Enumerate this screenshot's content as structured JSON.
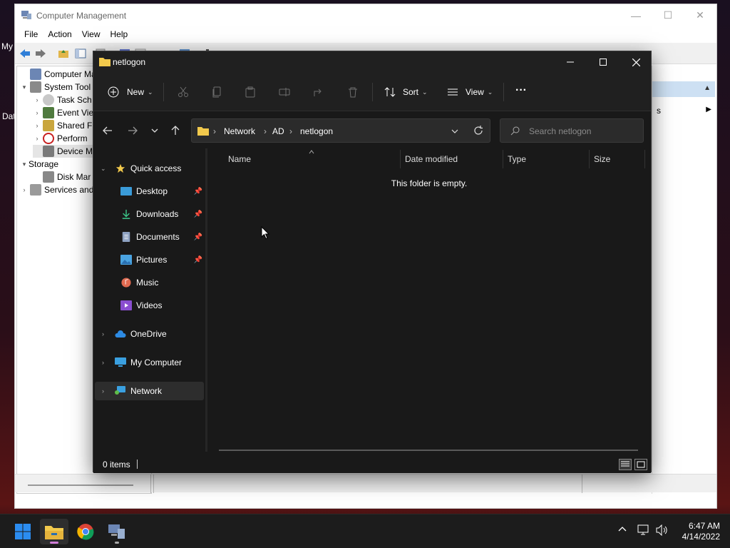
{
  "desktop": {
    "icon_label_top": "My",
    "icon_label_bottom": "Dat"
  },
  "computer_management": {
    "title": "Computer Management",
    "menu": [
      "File",
      "Action",
      "View",
      "Help"
    ],
    "tree": [
      {
        "label": "Computer Mana",
        "arrow": ""
      },
      {
        "label": "System Tool",
        "arrow": "▾"
      },
      {
        "label": "Task Sch",
        "arrow": "›"
      },
      {
        "label": "Event Vie",
        "arrow": "›"
      },
      {
        "label": "Shared F",
        "arrow": "›"
      },
      {
        "label": "Perform",
        "arrow": "›"
      },
      {
        "label": "Device M",
        "arrow": ""
      },
      {
        "label": "Storage",
        "arrow": "▾"
      },
      {
        "label": "Disk Mar",
        "arrow": ""
      },
      {
        "label": "Services and",
        "arrow": "›"
      }
    ],
    "right_pane_text": "s"
  },
  "explorer": {
    "title": "netlogon",
    "commands": {
      "new": "New",
      "sort": "Sort",
      "view": "View",
      "more": "···"
    },
    "breadcrumb": [
      "Network",
      "AD",
      "netlogon"
    ],
    "search_placeholder": "Search netlogon",
    "nav": {
      "quick_access": "Quick access",
      "desktop": "Desktop",
      "downloads": "Downloads",
      "documents": "Documents",
      "pictures": "Pictures",
      "music": "Music",
      "videos": "Videos",
      "onedrive": "OneDrive",
      "my_computer": "My Computer",
      "network": "Network"
    },
    "columns": {
      "name": "Name",
      "date_modified": "Date modified",
      "type": "Type",
      "size": "Size"
    },
    "empty_message": "This folder is empty.",
    "status_items": "0 items"
  },
  "taskbar": {
    "time": "6:47 AM",
    "date": "4/14/2022"
  },
  "colors": {
    "folder": "#f2c94c",
    "accent": "#0078d4",
    "indicator": "#d07dd8"
  }
}
